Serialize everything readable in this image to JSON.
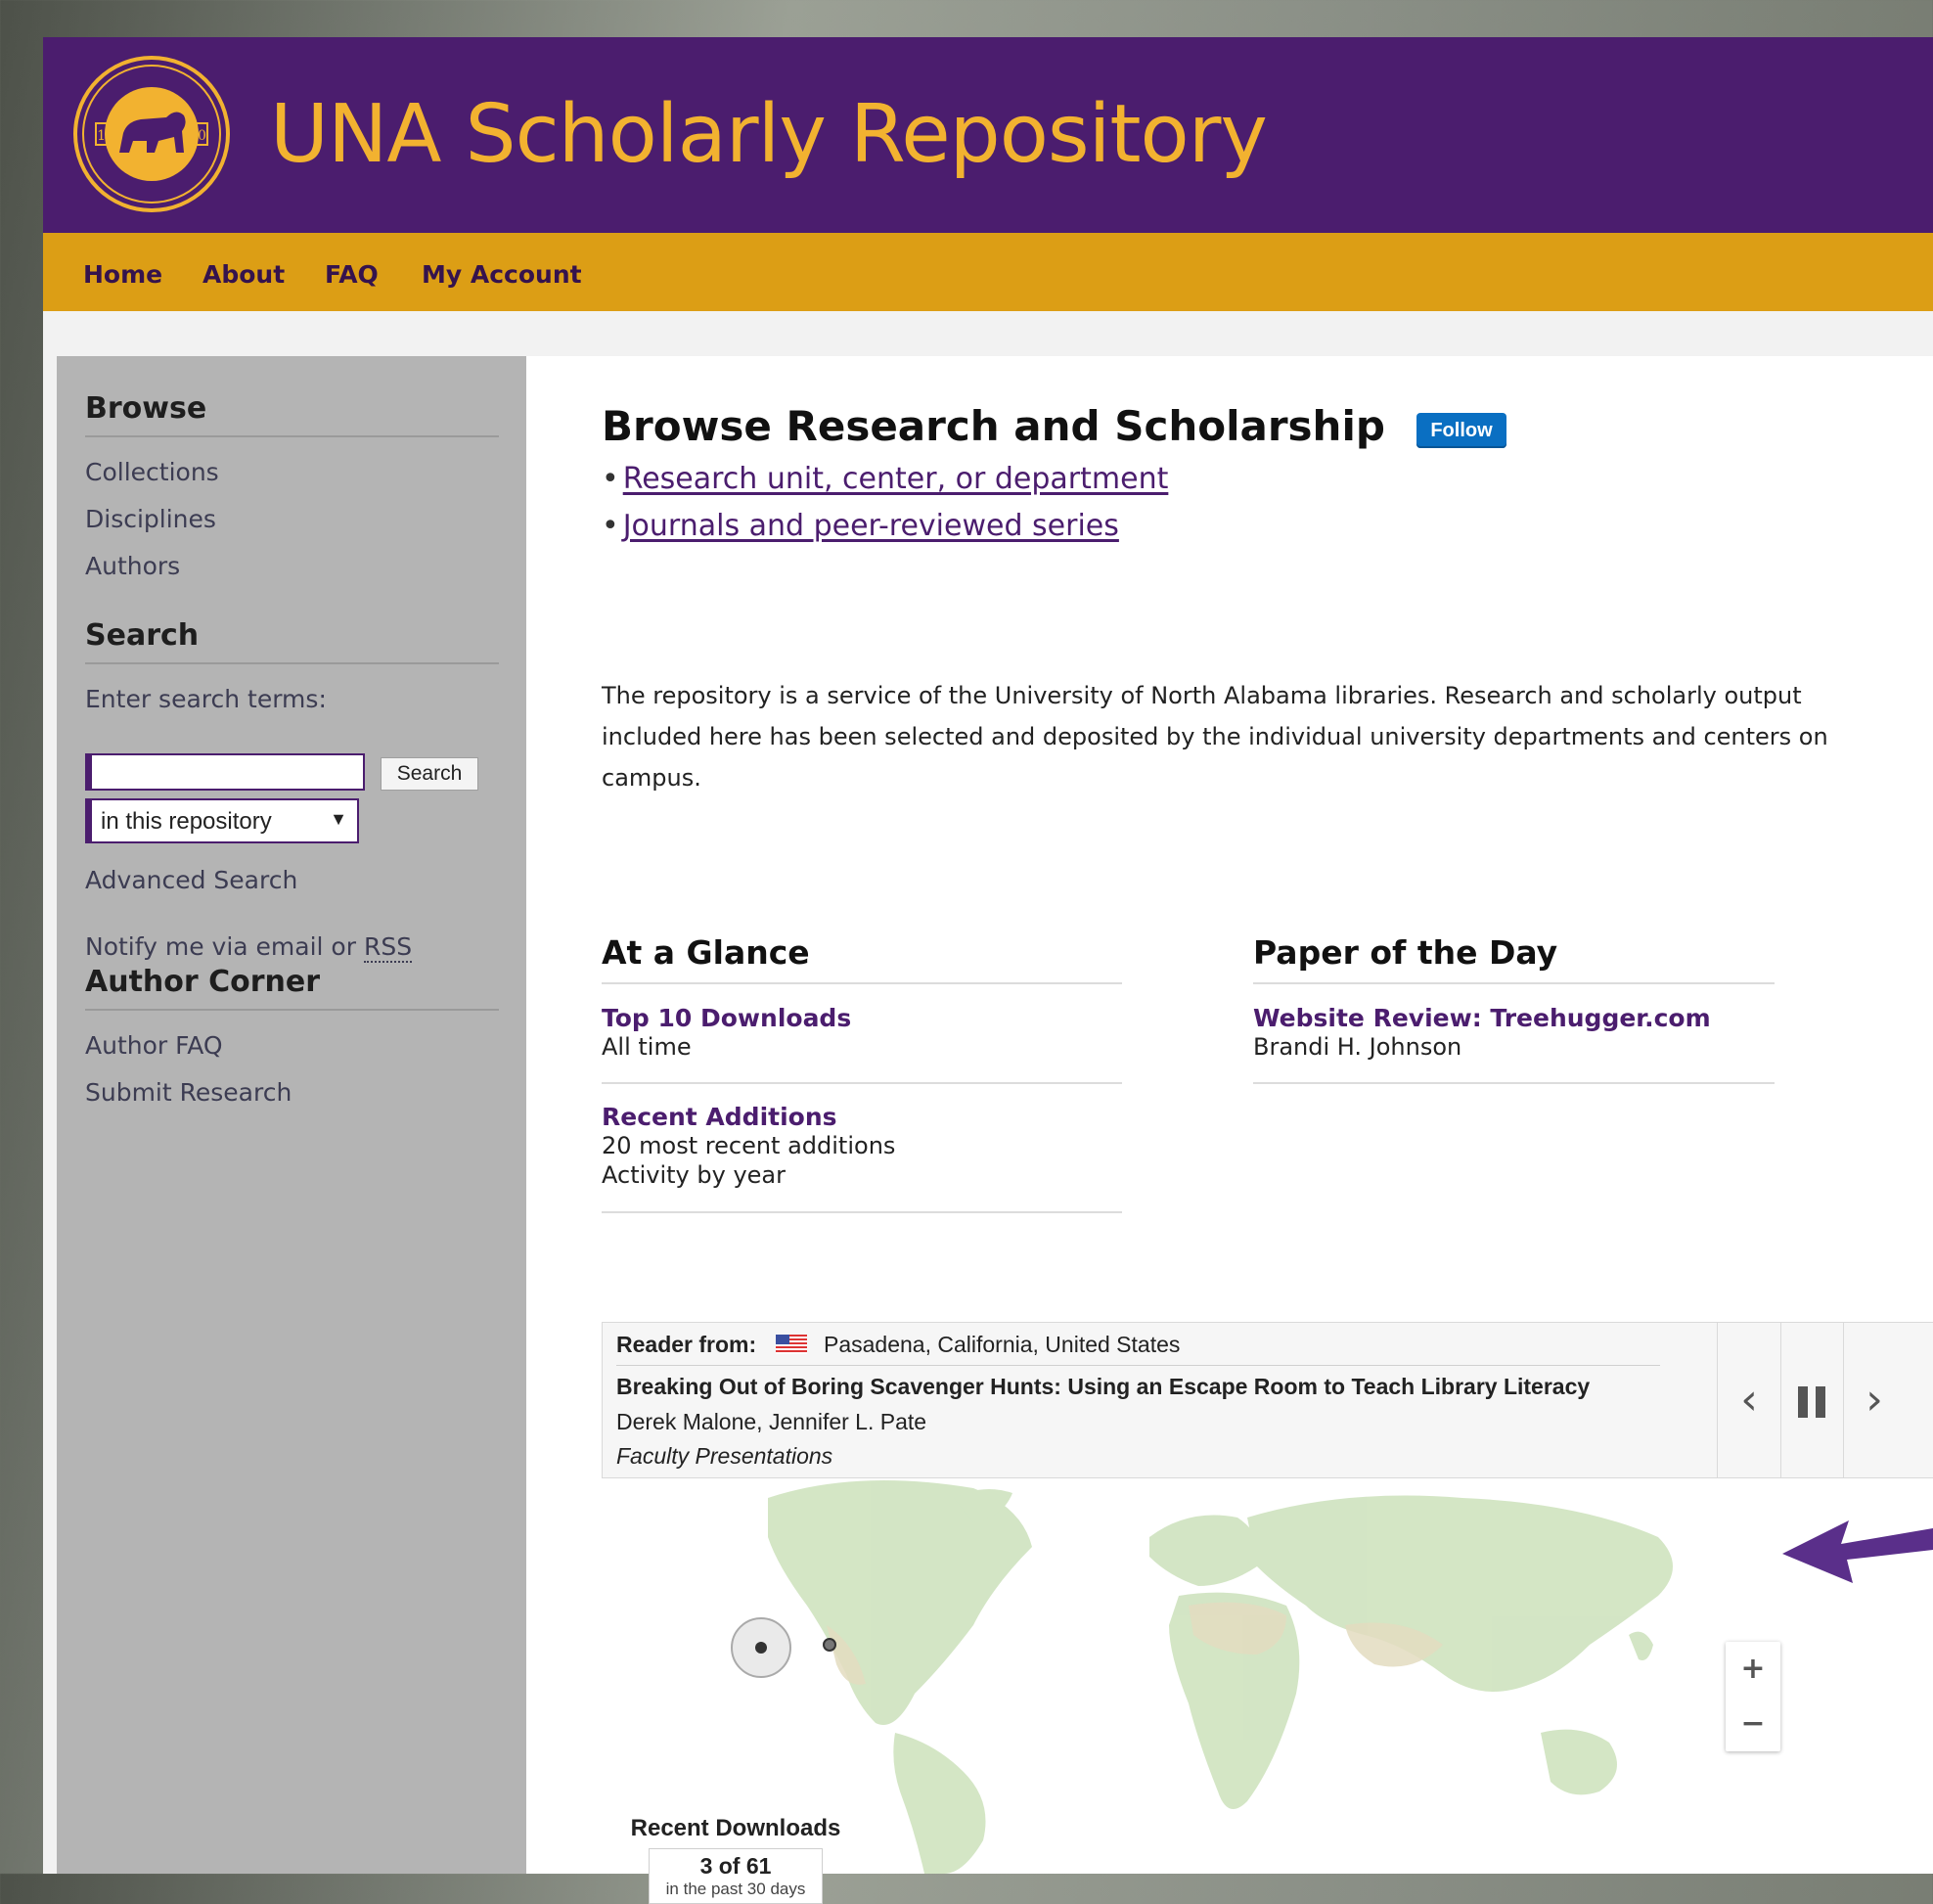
{
  "header": {
    "title": "UNA Scholarly Repository",
    "logo_icon": "university-seal-lion-icon"
  },
  "nav": {
    "items": [
      "Home",
      "About",
      "FAQ",
      "My Account"
    ]
  },
  "sidebar": {
    "browse": {
      "heading": "Browse",
      "links": [
        "Collections",
        "Disciplines",
        "Authors"
      ]
    },
    "search": {
      "heading": "Search",
      "label": "Enter search terms:",
      "input_value": "",
      "button": "Search",
      "scope_selected": "in this repository",
      "advanced": "Advanced Search",
      "notify_prefix": "Notify me via email or ",
      "notify_rss": "RSS"
    },
    "author_corner": {
      "heading": "Author Corner",
      "links": [
        "Author FAQ",
        "Submit Research"
      ]
    }
  },
  "main": {
    "heading": "Browse Research and Scholarship",
    "follow": "Follow",
    "browse_links": [
      "Research unit, center, or department",
      "Journals and peer-reviewed series"
    ],
    "intro": "The repository is a service of the University of North Alabama libraries. Research and scholarly output included here has been selected and deposited by the individual university departments and centers on campus.",
    "at_a_glance": {
      "heading": "At a Glance",
      "top_downloads": {
        "title": "Top 10 Downloads",
        "sub": "All time"
      },
      "recent_additions": {
        "title": "Recent Additions",
        "sub1": "20 most recent additions",
        "sub2": "Activity by year"
      }
    },
    "paper_of_day": {
      "heading": "Paper of the Day",
      "title": "Website Review: Treehugger.com",
      "author": "Brandi H. Johnson"
    },
    "reader": {
      "label": "Reader from:",
      "location": "Pasadena, California, United States",
      "flag_icon": "us-flag-icon",
      "title": "Breaking Out of Boring Scavenger Hunts: Using an Escape Room to Teach Library Literacy",
      "authors": "Derek Malone, Jennifer L. Pate",
      "series": "Faculty Presentations"
    },
    "map": {
      "zoom_in": "+",
      "zoom_out": "−",
      "downloads_label": "Recent Downloads",
      "downloads_count": "3 of 61",
      "downloads_period": "in the past 30 days"
    }
  },
  "colors": {
    "purple": "#4b1d6e",
    "gold": "#dc9e15",
    "title_gold": "#f2b230",
    "follow_blue": "#0a6fc2"
  }
}
